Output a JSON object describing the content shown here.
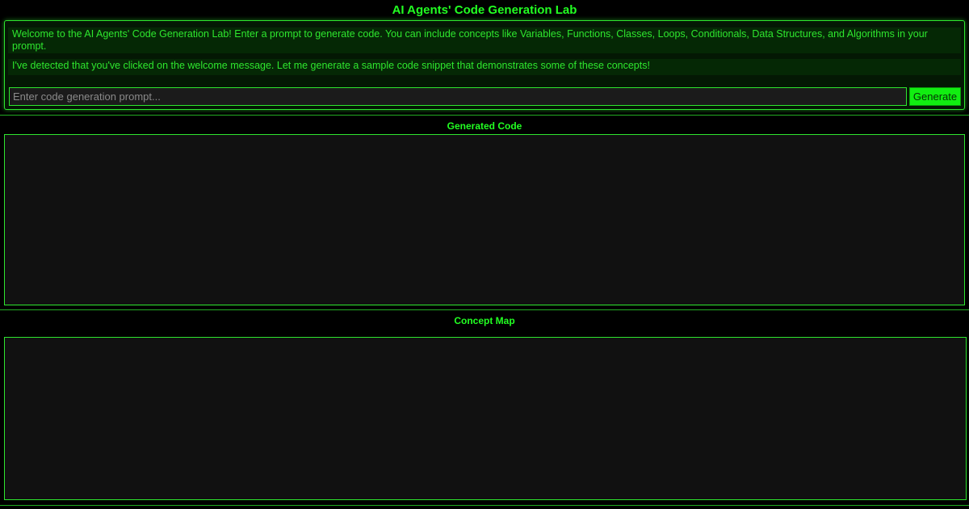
{
  "app": {
    "title": "AI Agents' Code Generation Lab"
  },
  "chat": {
    "messages": [
      "Welcome to the AI Agents' Code Generation Lab! Enter a prompt to generate code. You can include concepts like Variables, Functions, Classes, Loops, Conditionals, Data Structures, and Algorithms in your prompt.",
      "I've detected that you've clicked on the welcome message. Let me generate a sample code snippet that demonstrates some of these concepts!"
    ]
  },
  "prompt": {
    "value": "",
    "placeholder": "Enter code generation prompt...",
    "button_label": "Generate"
  },
  "sections": {
    "generated_code_title": "Generated Code",
    "concept_map_title": "Concept Map"
  },
  "colors": {
    "accent": "#2ee62e",
    "background": "#000000",
    "panel": "#111111",
    "button": "#11ee11"
  }
}
